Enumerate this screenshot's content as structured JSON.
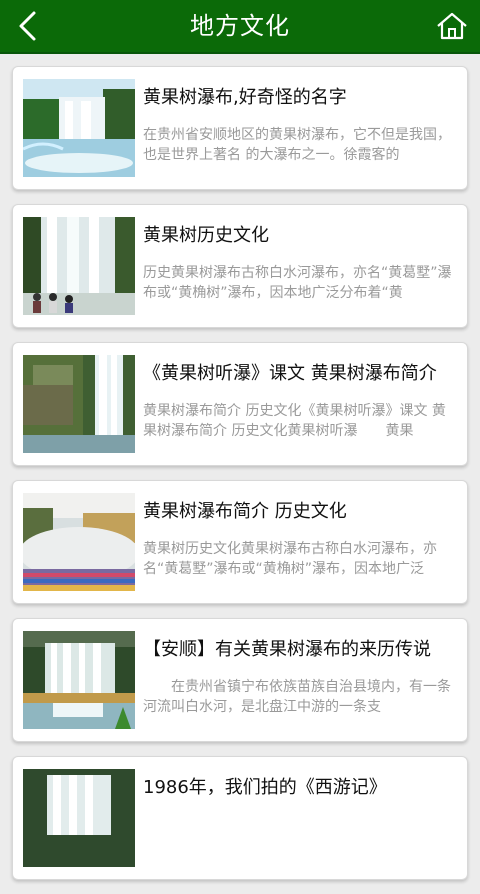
{
  "header": {
    "title": "地方文化",
    "back_icon": "back-arrow-icon",
    "home_icon": "home-icon",
    "bg_color": "#0b6a08"
  },
  "articles": [
    {
      "title": "黄果树瀑布,好奇怪的名字",
      "desc": "在贵州省安顺地区的黄果树瀑布，它不但是我国，也是世界上著名 的大瀑布之一。徐霞客的"
    },
    {
      "title": "黄果树历史文化",
      "desc": "历史黄果树瀑布古称白水河瀑布，亦名“黄葛墅”瀑布或“黄桷树”瀑布，因本地广泛分布着“黄"
    },
    {
      "title": "《黄果树听瀑》课文 黄果树瀑布简介",
      "desc": "黄果树瀑布简介 历史文化《黄果树听瀑》课文 黄果树瀑布简介 历史文化黄果树听瀑　　黄果"
    },
    {
      "title": "黄果树瀑布简介 历史文化",
      "desc": "黄果树历史文化黄果树瀑布古称白水河瀑布，亦名“黄葛墅”瀑布或“黄桷树”瀑布，因本地广泛"
    },
    {
      "title": "【安顺】有关黄果树瀑布的来历传说",
      "desc": "　　在贵州省镇宁布依族苗族自治县境内，有一条河流叫白水河，是北盘江中游的一条支"
    },
    {
      "title": "1986年，我们拍的《西游记》",
      "desc": ""
    }
  ]
}
